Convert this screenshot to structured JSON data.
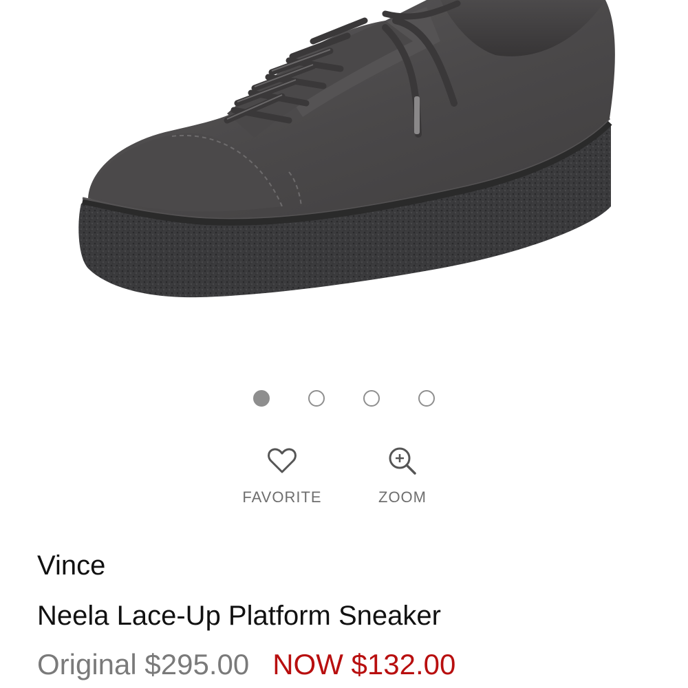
{
  "product": {
    "brand": "Vince",
    "name": "Neela Lace-Up Platform Sneaker",
    "image_alt": "Neela Lace-Up Platform Sneaker"
  },
  "carousel": {
    "total": 4,
    "active_index": 0
  },
  "actions": {
    "favorite_label": "FAVORITE",
    "zoom_label": "ZOOM"
  },
  "pricing": {
    "original_text": "Original $295.00",
    "now_text": "NOW $132.00"
  },
  "colors": {
    "sale_red": "#b80f0f",
    "muted_gray": "#7a7a7a",
    "icon_gray": "#555555"
  }
}
